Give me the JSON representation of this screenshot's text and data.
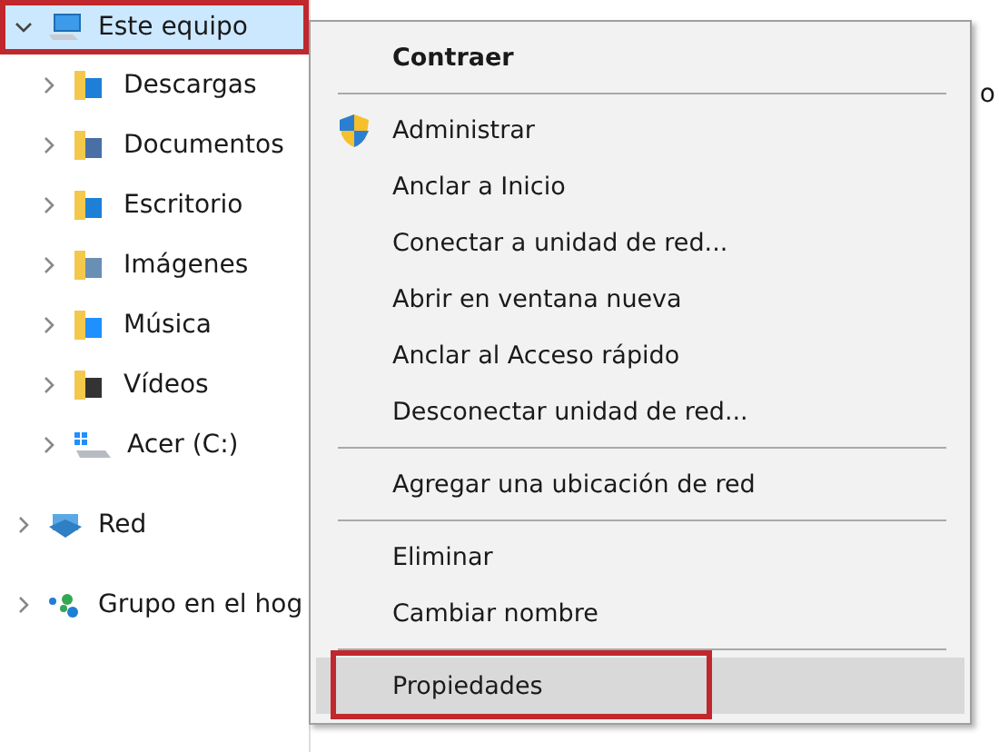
{
  "tree": [
    {
      "label": "Este equipo",
      "kind": "computer",
      "expanded": true,
      "selected": true,
      "annotated": true,
      "children": [
        {
          "label": "Descargas",
          "kind": "downloads",
          "expanded": false,
          "selected": false,
          "annotated": false
        },
        {
          "label": "Documentos",
          "kind": "documents",
          "expanded": false,
          "selected": false,
          "annotated": false
        },
        {
          "label": "Escritorio",
          "kind": "desktop",
          "expanded": false,
          "selected": false,
          "annotated": false
        },
        {
          "label": "Imágenes",
          "kind": "pictures",
          "expanded": false,
          "selected": false,
          "annotated": false
        },
        {
          "label": "Música",
          "kind": "music",
          "expanded": false,
          "selected": false,
          "annotated": false
        },
        {
          "label": "Vídeos",
          "kind": "videos",
          "expanded": false,
          "selected": false,
          "annotated": false
        },
        {
          "label": "Acer (C:)",
          "kind": "drive",
          "expanded": false,
          "selected": false,
          "annotated": false
        }
      ]
    },
    {
      "label": "Red",
      "kind": "network",
      "expanded": false,
      "selected": false,
      "annotated": false
    },
    {
      "label": "Grupo en el hog",
      "kind": "homegroup",
      "expanded": false,
      "selected": false,
      "annotated": false
    }
  ],
  "content_fragment": "o",
  "context_menu": [
    {
      "kind": "command",
      "label": "Contraer",
      "default": true,
      "shield": false,
      "selected": false,
      "annotated": false
    },
    {
      "kind": "separator"
    },
    {
      "kind": "command",
      "label": "Administrar",
      "default": false,
      "shield": true,
      "selected": false,
      "annotated": false
    },
    {
      "kind": "command",
      "label": "Anclar a Inicio",
      "default": false,
      "shield": false,
      "selected": false,
      "annotated": false
    },
    {
      "kind": "command",
      "label": "Conectar a unidad de red...",
      "default": false,
      "shield": false,
      "selected": false,
      "annotated": false
    },
    {
      "kind": "command",
      "label": "Abrir en ventana nueva",
      "default": false,
      "shield": false,
      "selected": false,
      "annotated": false
    },
    {
      "kind": "command",
      "label": "Anclar al Acceso rápido",
      "default": false,
      "shield": false,
      "selected": false,
      "annotated": false
    },
    {
      "kind": "command",
      "label": "Desconectar unidad de red...",
      "default": false,
      "shield": false,
      "selected": false,
      "annotated": false
    },
    {
      "kind": "separator"
    },
    {
      "kind": "command",
      "label": "Agregar una ubicación de red",
      "default": false,
      "shield": false,
      "selected": false,
      "annotated": false
    },
    {
      "kind": "separator"
    },
    {
      "kind": "command",
      "label": "Eliminar",
      "default": false,
      "shield": false,
      "selected": false,
      "annotated": false
    },
    {
      "kind": "command",
      "label": "Cambiar nombre",
      "default": false,
      "shield": false,
      "selected": false,
      "annotated": false
    },
    {
      "kind": "separator"
    },
    {
      "kind": "command",
      "label": "Propiedades",
      "default": false,
      "shield": false,
      "selected": true,
      "annotated": true
    }
  ]
}
